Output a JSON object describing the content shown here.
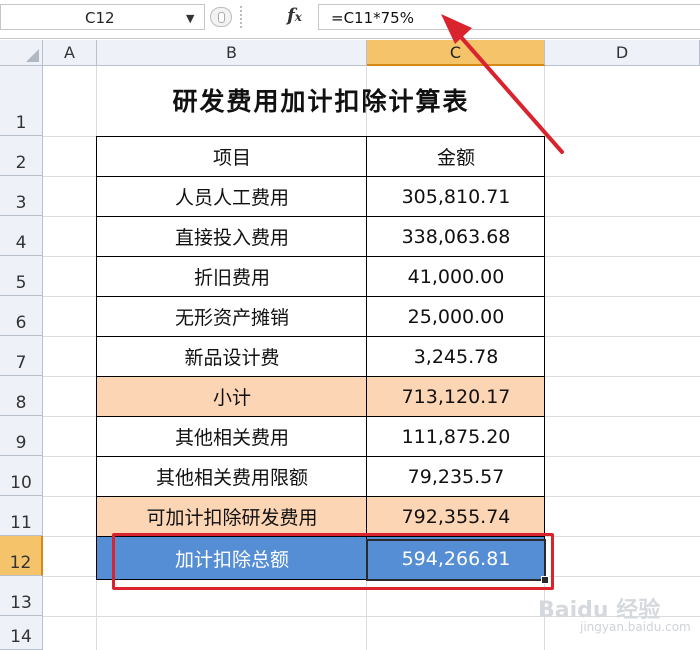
{
  "formula_bar": {
    "name_box": "C12",
    "fx_label": "fx",
    "formula": "=C11*75%"
  },
  "columns": [
    "A",
    "B",
    "C",
    "D"
  ],
  "rows": [
    "1",
    "2",
    "3",
    "4",
    "5",
    "6",
    "7",
    "8",
    "9",
    "10",
    "11",
    "12",
    "13",
    "14"
  ],
  "selected": {
    "column": "C",
    "row": "12"
  },
  "sheet": {
    "title": "研发费用加计扣除计算表",
    "header": {
      "item": "项目",
      "amount": "金额"
    },
    "items": [
      {
        "label": "人员人工费用",
        "amount": "305,810.71",
        "style": "plain"
      },
      {
        "label": "直接投入费用",
        "amount": "338,063.68",
        "style": "plain"
      },
      {
        "label": "折旧费用",
        "amount": "41,000.00",
        "style": "plain"
      },
      {
        "label": "无形资产摊销",
        "amount": "25,000.00",
        "style": "plain"
      },
      {
        "label": "新品设计费",
        "amount": "3,245.78",
        "style": "plain"
      },
      {
        "label": "小计",
        "amount": "713,120.17",
        "style": "peach"
      },
      {
        "label": "其他相关费用",
        "amount": "111,875.20",
        "style": "plain"
      },
      {
        "label": "其他相关费用限额",
        "amount": "79,235.57",
        "style": "plain"
      },
      {
        "label": "可加计扣除研发费用",
        "amount": "792,355.74",
        "style": "peach"
      },
      {
        "label": "加计扣除总额",
        "amount": "594,266.81",
        "style": "blue"
      }
    ]
  },
  "colors": {
    "peach": "#fcd5b4",
    "blue": "#558ed5",
    "highlight_header": "#f5c46a",
    "annotation_red": "#d9232d"
  },
  "watermark": {
    "brand": "Baidu 经验",
    "url": "jingyan.baidu.com"
  }
}
